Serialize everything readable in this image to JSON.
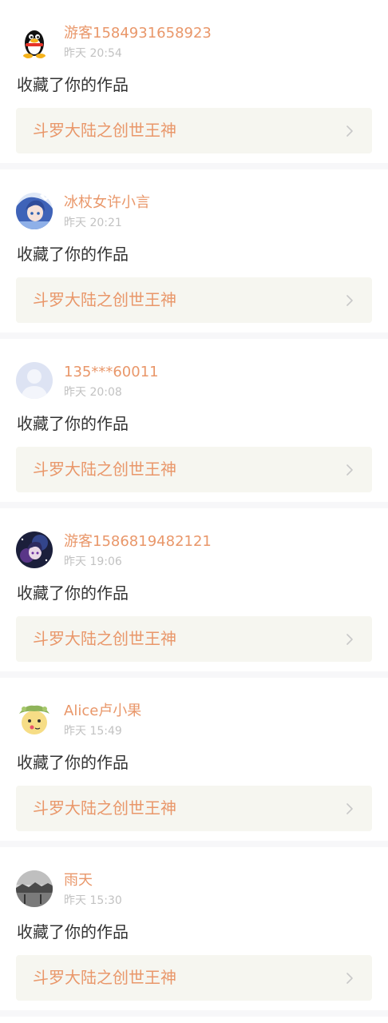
{
  "notifications": [
    {
      "username": "游客1584931658923",
      "time": "昨天 20:54",
      "action": "收藏了你的作品",
      "work_title": "斗罗大陆之创世王神",
      "avatar_icon": "qq-penguin-avatar"
    },
    {
      "username": "冰杖女许小言",
      "time": "昨天 20:21",
      "action": "收藏了你的作品",
      "work_title": "斗罗大陆之创世王神",
      "avatar_icon": "anime-girl-avatar"
    },
    {
      "username": "135***60011",
      "time": "昨天 20:08",
      "action": "收藏了你的作品",
      "work_title": "斗罗大陆之创世王神",
      "avatar_icon": "default-user-avatar"
    },
    {
      "username": "游客1586819482121",
      "time": "昨天 19:06",
      "action": "收藏了你的作品",
      "work_title": "斗罗大陆之创世王神",
      "avatar_icon": "anime-dark-avatar"
    },
    {
      "username": "Alice卢小果",
      "time": "昨天 15:49",
      "action": "收藏了你的作品",
      "work_title": "斗罗大陆之创世王神",
      "avatar_icon": "cartoon-face-avatar"
    },
    {
      "username": "雨天",
      "time": "昨天 15:30",
      "action": "收藏了你的作品",
      "work_title": "斗罗大陆之创世王神",
      "avatar_icon": "grayscale-photo-avatar"
    }
  ],
  "colors": {
    "accent": "#e9976a",
    "muted": "#c2c2c2",
    "text": "#333333",
    "link_bg": "#f6f6f0",
    "separator": "#f7f7f9"
  }
}
